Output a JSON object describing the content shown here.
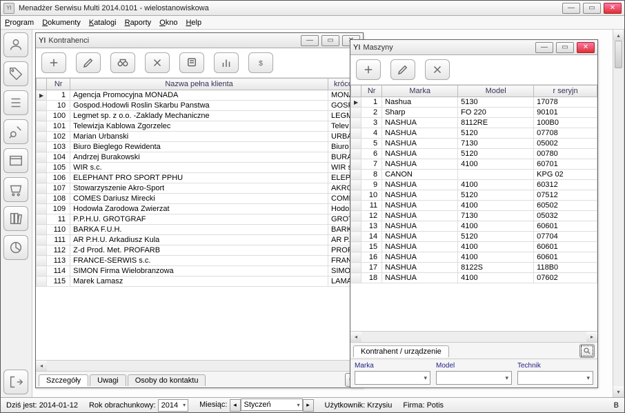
{
  "app": {
    "icon_text": "YI",
    "title": "Menadżer Serwisu Multi 2014.0101 - wielostanowiskowa"
  },
  "menu": {
    "items": [
      "Program",
      "Dokumenty",
      "Katalogi",
      "Raporty",
      "Okno",
      "Help"
    ]
  },
  "sidebar": {
    "icons": [
      "person-icon",
      "tag-icon",
      "list-icon",
      "gear-chart-icon",
      "window-icon",
      "cart-icon",
      "books-icon",
      "pie-icon",
      "exit-icon"
    ]
  },
  "kontrahenci": {
    "title": "Kontrahenci",
    "toolbar": [
      "add",
      "edit",
      "search-binoculars",
      "delete",
      "note",
      "chart",
      "money"
    ],
    "columns": {
      "nr": "Nr",
      "nazwa": "Nazwa pełna klienta",
      "skrot": "krócon"
    },
    "rows": [
      {
        "nr": "1",
        "nazwa": "Agencja Promocyjna MONADA",
        "skrot": "MONA"
      },
      {
        "nr": "10",
        "nazwa": "Gospod.Hodowli Roslin Skarbu Panstwa",
        "skrot": "GOSP"
      },
      {
        "nr": "100",
        "nazwa": "Legmet sp. z o.o. -Zaklady Mechaniczne",
        "skrot": "LEGM"
      },
      {
        "nr": "101",
        "nazwa": "Telewizja Kablowa Zgorzelec",
        "skrot": "Telev"
      },
      {
        "nr": "102",
        "nazwa": "Marian Urbanski",
        "skrot": "URBA"
      },
      {
        "nr": "103",
        "nazwa": "Biuro Bieglego Rewidenta",
        "skrot": "Biuro"
      },
      {
        "nr": "104",
        "nazwa": "Andrzej Burakowski",
        "skrot": "BURA"
      },
      {
        "nr": "105",
        "nazwa": "WIR s.c.",
        "skrot": "WIR s"
      },
      {
        "nr": "106",
        "nazwa": "ELEPHANT PRO SPORT PPHU",
        "skrot": "ELEPH"
      },
      {
        "nr": "107",
        "nazwa": "Stowarzyszenie Akro-Sport",
        "skrot": "AKRO"
      },
      {
        "nr": "108",
        "nazwa": "COMES Dariusz Mirecki",
        "skrot": "COME"
      },
      {
        "nr": "109",
        "nazwa": "Hodowla Zarodowa Zwierzat",
        "skrot": "Hodo"
      },
      {
        "nr": "11",
        "nazwa": "P.P.H.U. GROTGRAF",
        "skrot": "GROT"
      },
      {
        "nr": "110",
        "nazwa": "BARKA F.U.H.",
        "skrot": "BARK"
      },
      {
        "nr": "111",
        "nazwa": "AR P.H.U. Arkadiusz Kula",
        "skrot": "AR P."
      },
      {
        "nr": "112",
        "nazwa": "Z-d Prod. Met. PROFARB",
        "skrot": "PROF"
      },
      {
        "nr": "113",
        "nazwa": "FRANCE-SERWIS s.c.",
        "skrot": "FRAN"
      },
      {
        "nr": "114",
        "nazwa": "SIMON Firma Wielobranzowa",
        "skrot": "SIMO"
      },
      {
        "nr": "115",
        "nazwa": "Marek Lamasz",
        "skrot": "LAMA"
      }
    ],
    "tabs": [
      "Szczegóły",
      "Uwagi",
      "Osoby do kontaktu"
    ]
  },
  "maszyny": {
    "title": "Maszyny",
    "toolbar": [
      "add",
      "edit",
      "delete"
    ],
    "columns": {
      "nr": "Nr",
      "marka": "Marka",
      "model": "Model",
      "serial": "r seryjn"
    },
    "rows": [
      {
        "nr": "1",
        "marka": "Nashua",
        "model": "5130",
        "serial": "17078"
      },
      {
        "nr": "2",
        "marka": "Sharp",
        "model": "FO 220",
        "serial": "90101"
      },
      {
        "nr": "3",
        "marka": "NASHUA",
        "model": "8112RE",
        "serial": "100B0"
      },
      {
        "nr": "4",
        "marka": "NASHUA",
        "model": "5120",
        "serial": "07708"
      },
      {
        "nr": "5",
        "marka": "NASHUA",
        "model": "7130",
        "serial": "05002"
      },
      {
        "nr": "6",
        "marka": "NASHUA",
        "model": "5120",
        "serial": "00780"
      },
      {
        "nr": "7",
        "marka": "NASHUA",
        "model": "4100",
        "serial": "60701"
      },
      {
        "nr": "8",
        "marka": "CANON",
        "model": "",
        "serial": "KPG 02"
      },
      {
        "nr": "9",
        "marka": "NASHUA",
        "model": "4100",
        "serial": "60312"
      },
      {
        "nr": "10",
        "marka": "NASHUA",
        "model": "5120",
        "serial": "07512"
      },
      {
        "nr": "11",
        "marka": "NASHUA",
        "model": "4100",
        "serial": "60502"
      },
      {
        "nr": "12",
        "marka": "NASHUA",
        "model": "7130",
        "serial": "05032"
      },
      {
        "nr": "13",
        "marka": "NASHUA",
        "model": "4100",
        "serial": "60601"
      },
      {
        "nr": "14",
        "marka": "NASHUA",
        "model": "5120",
        "serial": "07704"
      },
      {
        "nr": "15",
        "marka": "NASHUA",
        "model": "4100",
        "serial": "60601"
      },
      {
        "nr": "16",
        "marka": "NASHUA",
        "model": "4100",
        "serial": "60601"
      },
      {
        "nr": "17",
        "marka": "NASHUA",
        "model": "8122S",
        "serial": "118B0"
      },
      {
        "nr": "18",
        "marka": "NASHUA",
        "model": "4100",
        "serial": "07602"
      }
    ],
    "bottom_tab": "Kontrahent / urządzenie",
    "filters": {
      "marka": "Marka",
      "model": "Model",
      "technik": "Technik"
    }
  },
  "status": {
    "date_label": "Dziś jest:",
    "date_value": "2014-01-12",
    "year_label": "Rok obrachunkowy:",
    "year_value": "2014",
    "month_label": "Miesiąc:",
    "month_value": "Styczeń",
    "user_label": "Użytkownik:",
    "user_value": "Krzysiu",
    "firm_label": "Firma:",
    "firm_value": "Potis",
    "extra": "B"
  }
}
